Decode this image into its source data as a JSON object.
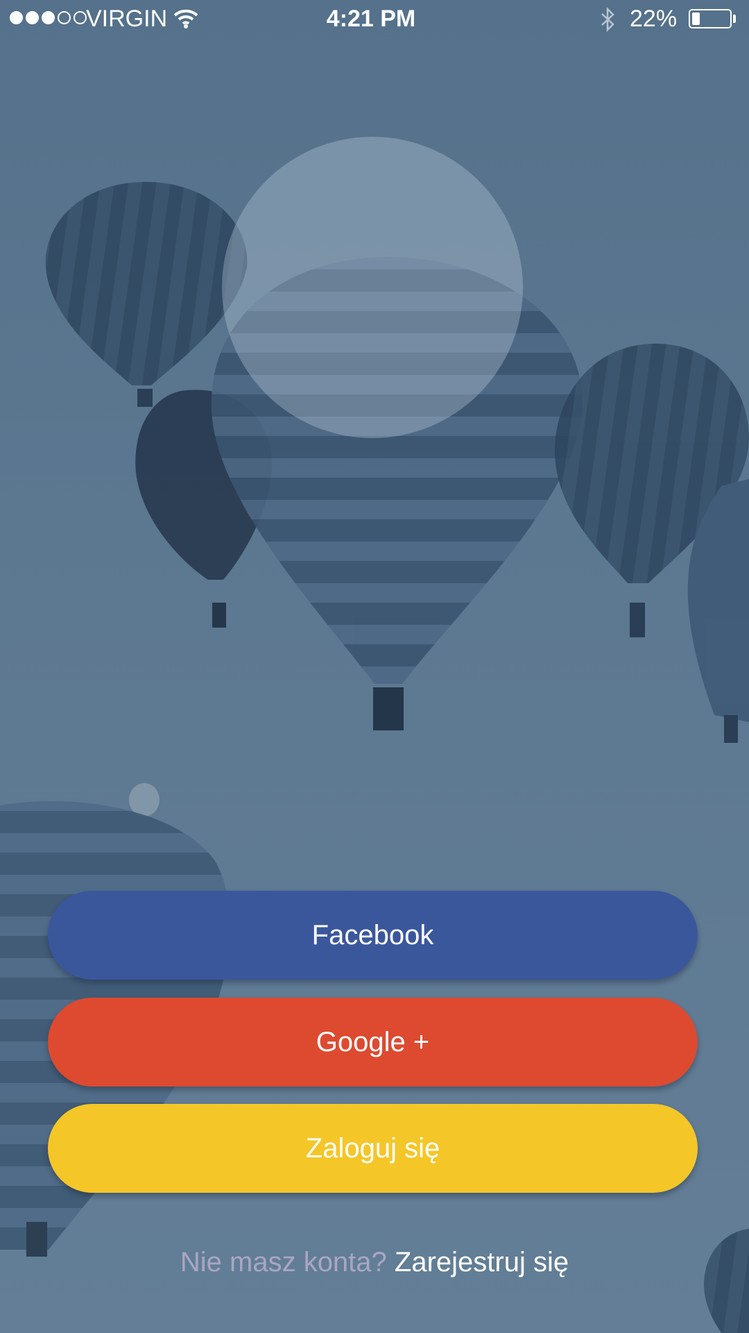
{
  "status_bar": {
    "carrier": "VIRGIN",
    "time": "4:21 PM",
    "battery_percent": "22%",
    "battery_level": 0.22,
    "signal_bars_filled": 3,
    "signal_bars_total": 5,
    "icons": [
      "wifi-icon",
      "bluetooth-icon",
      "battery-icon"
    ]
  },
  "buttons": {
    "facebook": "Facebook",
    "google": "Google +",
    "login": "Zaloguj się"
  },
  "signup": {
    "prompt": "Nie masz konta?",
    "link": "Zarejestruj się"
  },
  "colors": {
    "facebook": "#3b579c",
    "google": "#dd4a30",
    "login": "#f4c628",
    "background_tint": "#5d7891"
  }
}
